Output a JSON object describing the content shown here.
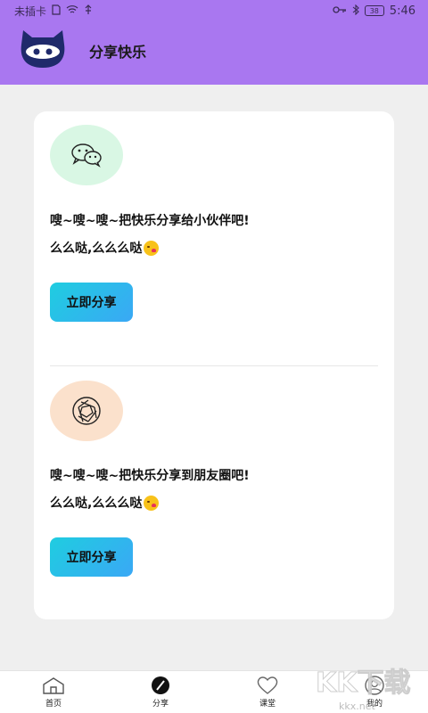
{
  "status_bar": {
    "carrier": "未插卡",
    "battery": "38",
    "time": "5:46"
  },
  "header": {
    "title": "分享快乐"
  },
  "share_items": [
    {
      "icon": "wechat-icon",
      "text": "嗖~嗖~嗖~把快乐分享给小伙伴吧!",
      "kiss_text": "么么哒,么么么哒",
      "button_label": "立即分享"
    },
    {
      "icon": "moments-icon",
      "text": "嗖~嗖~嗖~把快乐分享到朋友圈吧!",
      "kiss_text": "么么哒,么么么哒",
      "button_label": "立即分享"
    }
  ],
  "bottom_nav": {
    "items": [
      {
        "label": "首页",
        "icon": "home-icon"
      },
      {
        "label": "分享",
        "icon": "share-icon",
        "active": true
      },
      {
        "label": "课堂",
        "icon": "heart-icon"
      },
      {
        "label": "我的",
        "icon": "profile-icon"
      }
    ]
  },
  "watermark": {
    "brand": "KK下载",
    "url": "kkx.net"
  },
  "colors": {
    "header_bg": "#a977f0",
    "button_gradient_start": "#1fcde0",
    "button_gradient_end": "#3aa8f5",
    "wechat_circle": "#d9f7e4",
    "moments_circle": "#fbe1cc"
  }
}
